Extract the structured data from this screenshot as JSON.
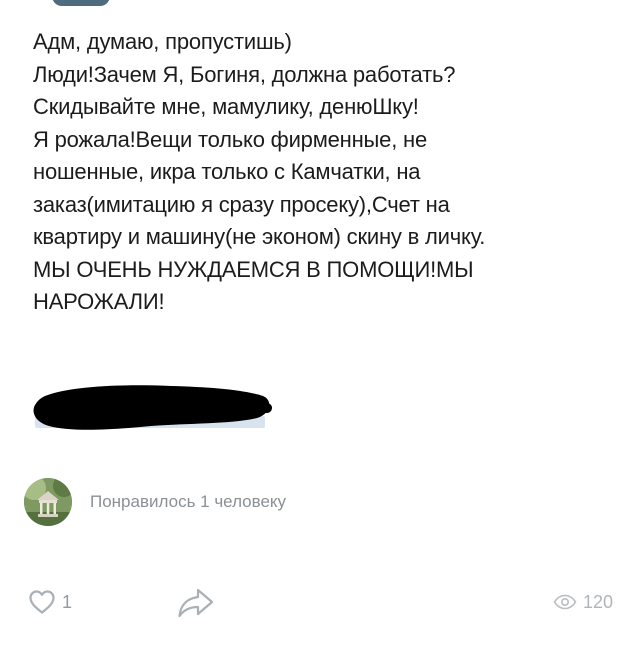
{
  "post": {
    "lines": [
      "Адм, думаю, пропустишь)",
      "Люди!Зачем Я, Богиня, должна работать?",
      "Скидывайте мне, мамулику, денюШку!",
      "Я рожала!Вещи только фирменные, не",
      "ношенные, икра только с Камчатки, на",
      "заказ(имитацию я сразу просеку),Счет на",
      "квартиру и машину(не эконом) скину в личку.",
      "МЫ ОЧЕНЬ НУЖДАЕМСЯ В ПОМОЩИ!МЫ",
      "НАРОЖАЛИ!"
    ]
  },
  "likes_summary": {
    "text": "Понравилось 1 человеку"
  },
  "actions": {
    "like_count": "1",
    "views_count": "120"
  },
  "icons": {
    "like": "heart-icon",
    "share": "share-arrow-icon",
    "views": "eye-icon",
    "redaction": "redaction-scribble",
    "avatar": "avatar-gazebo-photo"
  },
  "colors": {
    "text": "#1c1c1c",
    "muted": "#8a9096",
    "icon": "#a9b0b6",
    "redaction": "#000000"
  }
}
